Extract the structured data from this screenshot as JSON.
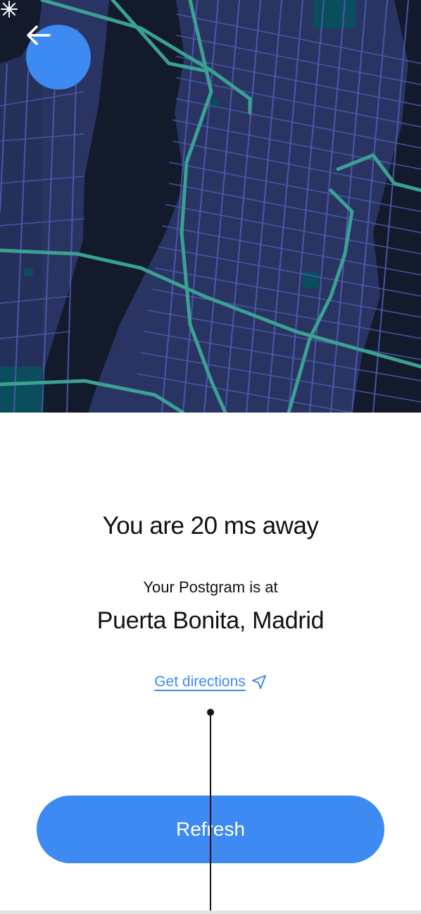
{
  "map": {
    "background": "#2a3462",
    "water_color": "#121a2c",
    "park_color": "#0a4d5c",
    "street_color": "#4d5cb0",
    "highway_color": "#3aa193"
  },
  "header": {
    "back_icon": "arrow-left-icon"
  },
  "marker": {
    "icon": "asterisk-marker-icon"
  },
  "main": {
    "title": "You are 20 ms away",
    "subtitle": "Your Postgram is at",
    "location": "Puerta Bonita, Madrid",
    "directions_label": "Get directions",
    "directions_icon": "navigation-arrow-icon",
    "refresh_label": "Refresh"
  },
  "colors": {
    "accent": "#3d8af2",
    "text": "#111111"
  }
}
